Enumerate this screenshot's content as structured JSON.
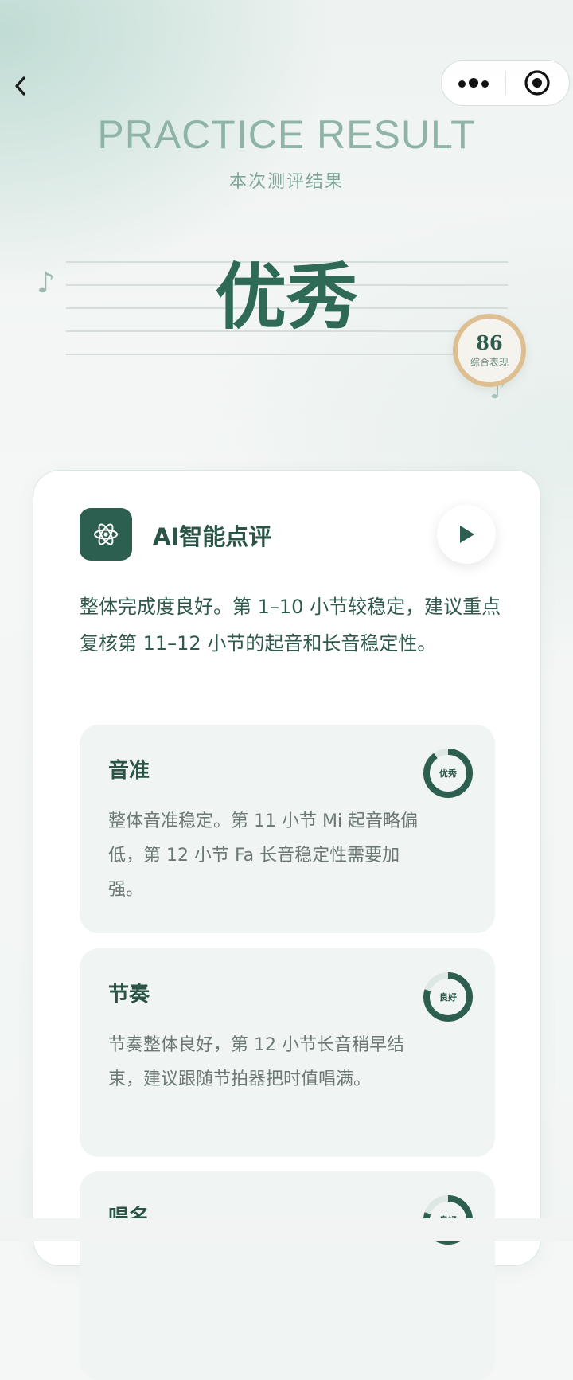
{
  "nav": {
    "back_icon": "chevron-left-icon",
    "more_icon": "more-dots-icon",
    "close_icon": "target-close-icon"
  },
  "header": {
    "title_en": "PRACTICE RESULT",
    "title_cn": "本次测评结果",
    "grade": "优秀",
    "score": "86",
    "score_label": "综合表现"
  },
  "ai_review": {
    "icon": "atom-icon",
    "title": "AI智能点评",
    "play_icon": "play-icon",
    "summary": "整体完成度良好。第 1–10 小节较稳定，建议重点复核第 11–12 小节的起音和长音稳定性。",
    "items": [
      {
        "title": "音准",
        "text": "整体音准稳定。第 11 小节 Mi 起音略偏低，第 12 小节 Fa 长音稳定性需要加强。",
        "badge": "优秀",
        "level": 0.9
      },
      {
        "title": "节奏",
        "text": "节奏整体良好，第 12 小节长音稍早结束，建议跟随节拍器把时值唱满。",
        "badge": "良好",
        "level": 0.8
      },
      {
        "title": "唱名",
        "text": "",
        "badge": "良好",
        "level": 0.8
      }
    ]
  },
  "colors": {
    "primary": "#2c5f4f",
    "accent_gold": "#ddbf92",
    "ring_track": "#dde8e4"
  }
}
